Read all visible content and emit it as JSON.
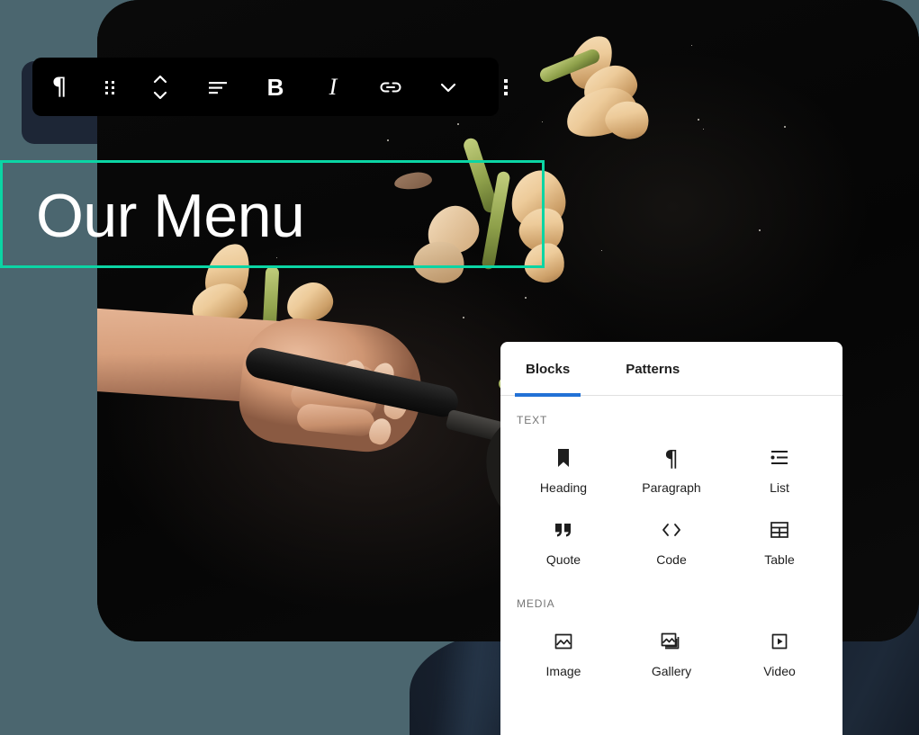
{
  "canvas": {
    "background_color": "#4b666f",
    "accent_navy": "#18212f"
  },
  "hero": {
    "name": "restaurant-hero-image",
    "description": "Hand holding a frying pan tossing shrimp and asparagus on a black background",
    "background_color": "#070707"
  },
  "heading_block": {
    "text": "Our Menu",
    "selected": true,
    "selection_color": "#0bd5a4",
    "text_color": "#ffffff"
  },
  "block_toolbar": {
    "background_color": "#000000",
    "buttons": [
      {
        "name": "paragraph-block-type-icon",
        "label": "Paragraph",
        "glyph": "¶"
      },
      {
        "name": "drag-handle-icon",
        "label": "Drag"
      },
      {
        "name": "move-up-down-icon",
        "label": "Move up or down"
      },
      {
        "name": "align-text-icon",
        "label": "Align text"
      },
      {
        "name": "bold-icon",
        "label": "B"
      },
      {
        "name": "italic-icon",
        "label": "I"
      },
      {
        "name": "link-icon",
        "label": "Link"
      },
      {
        "name": "chevron-down-icon",
        "label": "More rich text controls"
      },
      {
        "name": "more-options-icon",
        "label": "Options"
      }
    ]
  },
  "inserter": {
    "tabs": [
      {
        "label": "Blocks",
        "active": true
      },
      {
        "label": "Patterns",
        "active": false
      }
    ],
    "active_tab_color": "#2271d6",
    "sections": [
      {
        "title": "TEXT",
        "items": [
          {
            "label": "Heading",
            "icon": "heading-icon"
          },
          {
            "label": "Paragraph",
            "icon": "paragraph-icon"
          },
          {
            "label": "List",
            "icon": "list-icon"
          },
          {
            "label": "Quote",
            "icon": "quote-icon"
          },
          {
            "label": "Code",
            "icon": "code-icon"
          },
          {
            "label": "Table",
            "icon": "table-icon"
          }
        ]
      },
      {
        "title": "MEDIA",
        "items": [
          {
            "label": "Image",
            "icon": "image-icon"
          },
          {
            "label": "Gallery",
            "icon": "gallery-icon"
          },
          {
            "label": "Video",
            "icon": "video-icon"
          }
        ]
      }
    ]
  }
}
